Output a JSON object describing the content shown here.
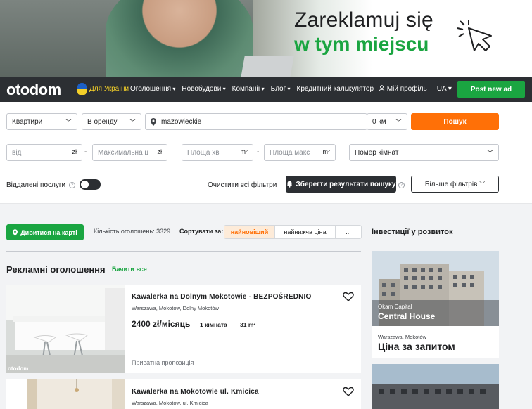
{
  "banner": {
    "headline": "Zareklamuj się",
    "subline": "w tym miejscu"
  },
  "nav": {
    "logo": "otodom",
    "ukraine": "Для України",
    "links": [
      "Оголошення",
      "Новобудови",
      "Компанії",
      "Блог",
      "Кредитний калькулятор"
    ],
    "profile": "Мій профіль",
    "lang": "UA",
    "post_ad": "Post new ad"
  },
  "filters": {
    "type": "Квартири",
    "transaction": "В оренду",
    "location": "mazowieckie",
    "radius": "0 км",
    "search": "Пошук",
    "price_from_placeholder": "від",
    "price_currency": "zł",
    "price_to_placeholder": "Максимальна ціна",
    "area_from_placeholder": "Площа хв",
    "area_unit": "m²",
    "area_to_placeholder": "Площа макс",
    "rooms": "Номер кімнат",
    "remote": "Віддалені послуги",
    "clear": "Очистити всі фільтри",
    "save": "Зберегти результати пошуку",
    "more": "Більше фільтрів"
  },
  "results": {
    "map_button": "Дивитися на карті",
    "count_label": "Кількість оголошень: 3329",
    "sort_label": "Сортувати за:",
    "sort_options": [
      "найновіший",
      "найнижча ціна",
      "..."
    ],
    "promo_title": "Рекламні оголошення",
    "see_all": "Бачити все",
    "listings": [
      {
        "title": "Kawalerka na Dolnym Mokotowie - BEZPOŚREDNIO",
        "address": "Warszawa, Mokotów, Dolny Mokotów",
        "price": "2400 zł/місяць",
        "rooms": "1 кімната",
        "area": "31 m²",
        "owner": "Приватна пропозиція",
        "watermark": "otodom"
      },
      {
        "title": "Kawalerka na Mokotowie ul. Kmicica",
        "address": "Warszawa, Mokotów, ul. Kmicica"
      }
    ]
  },
  "sidebar": {
    "title": "Інвестиції у розвиток",
    "investment": {
      "developer": "Okam Capital",
      "name": "Central House",
      "address": "Warszawa, Mokotów",
      "price": "Ціна за запитом"
    }
  },
  "colors": {
    "brand_green": "#1aa541",
    "accent_orange": "#ff7007",
    "nav_dark": "#2c2f33"
  }
}
